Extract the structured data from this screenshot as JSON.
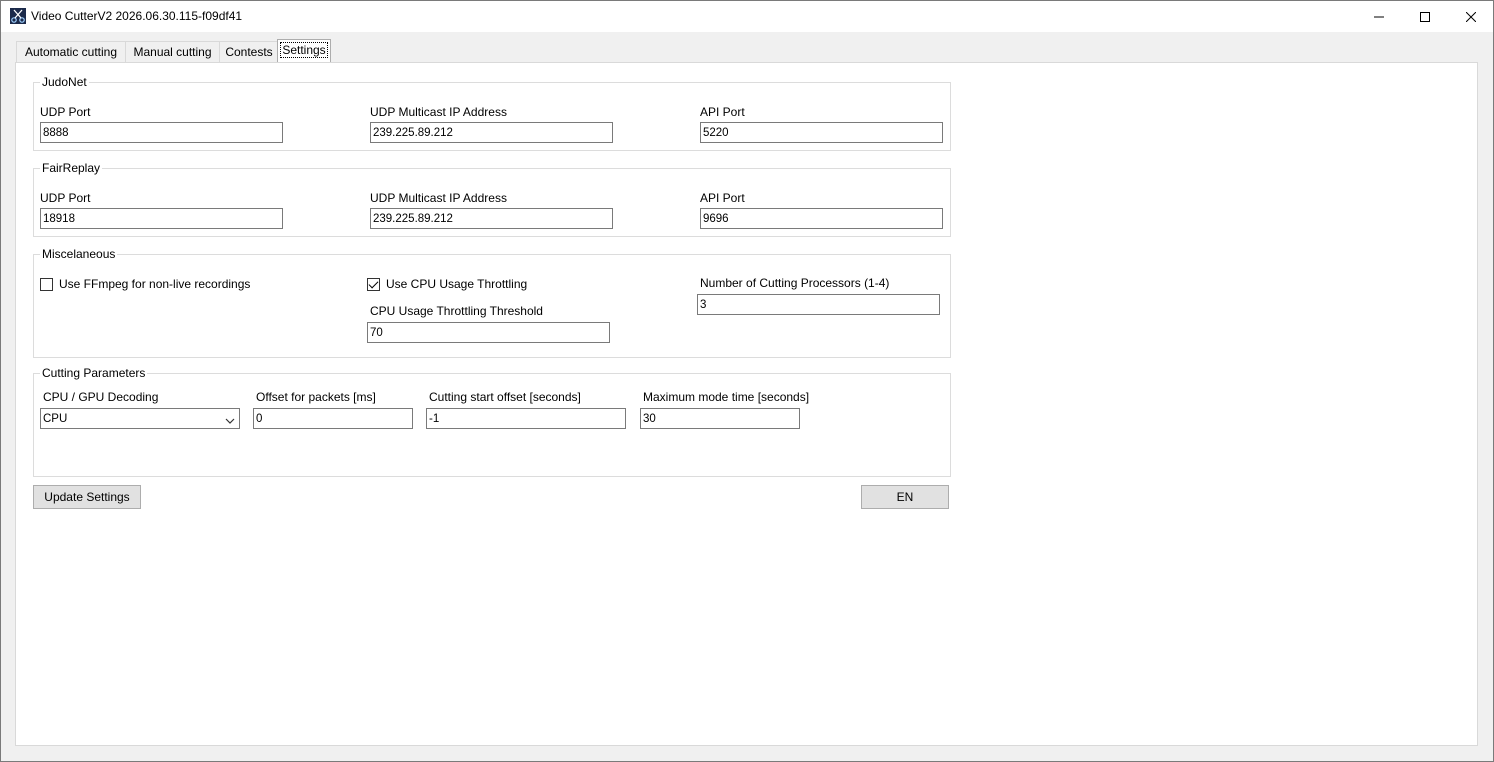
{
  "window": {
    "title": "Video CutterV2 2026.06.30.115-f09df41"
  },
  "tabs": [
    {
      "label": "Automatic cutting"
    },
    {
      "label": "Manual cutting"
    },
    {
      "label": "Contests"
    },
    {
      "label": "Settings",
      "active": true
    }
  ],
  "judonet": {
    "legend": "JudoNet",
    "udp_port_label": "UDP Port",
    "udp_port_value": "8888",
    "multicast_label": "UDP Multicast IP Address",
    "multicast_value": "239.225.89.212",
    "api_port_label": "API Port",
    "api_port_value": "5220"
  },
  "fairreplay": {
    "legend": "FairReplay",
    "udp_port_label": "UDP Port",
    "udp_port_value": "18918",
    "multicast_label": "UDP Multicast IP Address",
    "multicast_value": "239.225.89.212",
    "api_port_label": "API Port",
    "api_port_value": "9696"
  },
  "misc": {
    "legend": "Miscelaneous",
    "ffmpeg_label": "Use FFmpeg for non-live recordings",
    "ffmpeg_checked": false,
    "cpu_throttle_label": "Use CPU Usage Throttling",
    "cpu_throttle_checked": true,
    "threshold_label": "CPU Usage Throttling Threshold",
    "threshold_value": "70",
    "processors_label": "Number of Cutting Processors (1-4)",
    "processors_value": "3"
  },
  "cutting": {
    "legend": "Cutting Parameters",
    "decoding_label": "CPU / GPU Decoding",
    "decoding_value": "CPU",
    "offset_packets_label": "Offset for packets [ms]",
    "offset_packets_value": "0",
    "start_offset_label": "Cutting start offset [seconds]",
    "start_offset_value": "-1",
    "max_mode_label": "Maximum mode time [seconds]",
    "max_mode_value": "30"
  },
  "buttons": {
    "update_label": "Update Settings",
    "language_label": "EN"
  },
  "icons": {
    "app": "scissors-app-icon",
    "minimize": "minimize-icon",
    "maximize": "maximize-icon",
    "close": "close-icon",
    "dropdown": "chevron-down-icon"
  }
}
